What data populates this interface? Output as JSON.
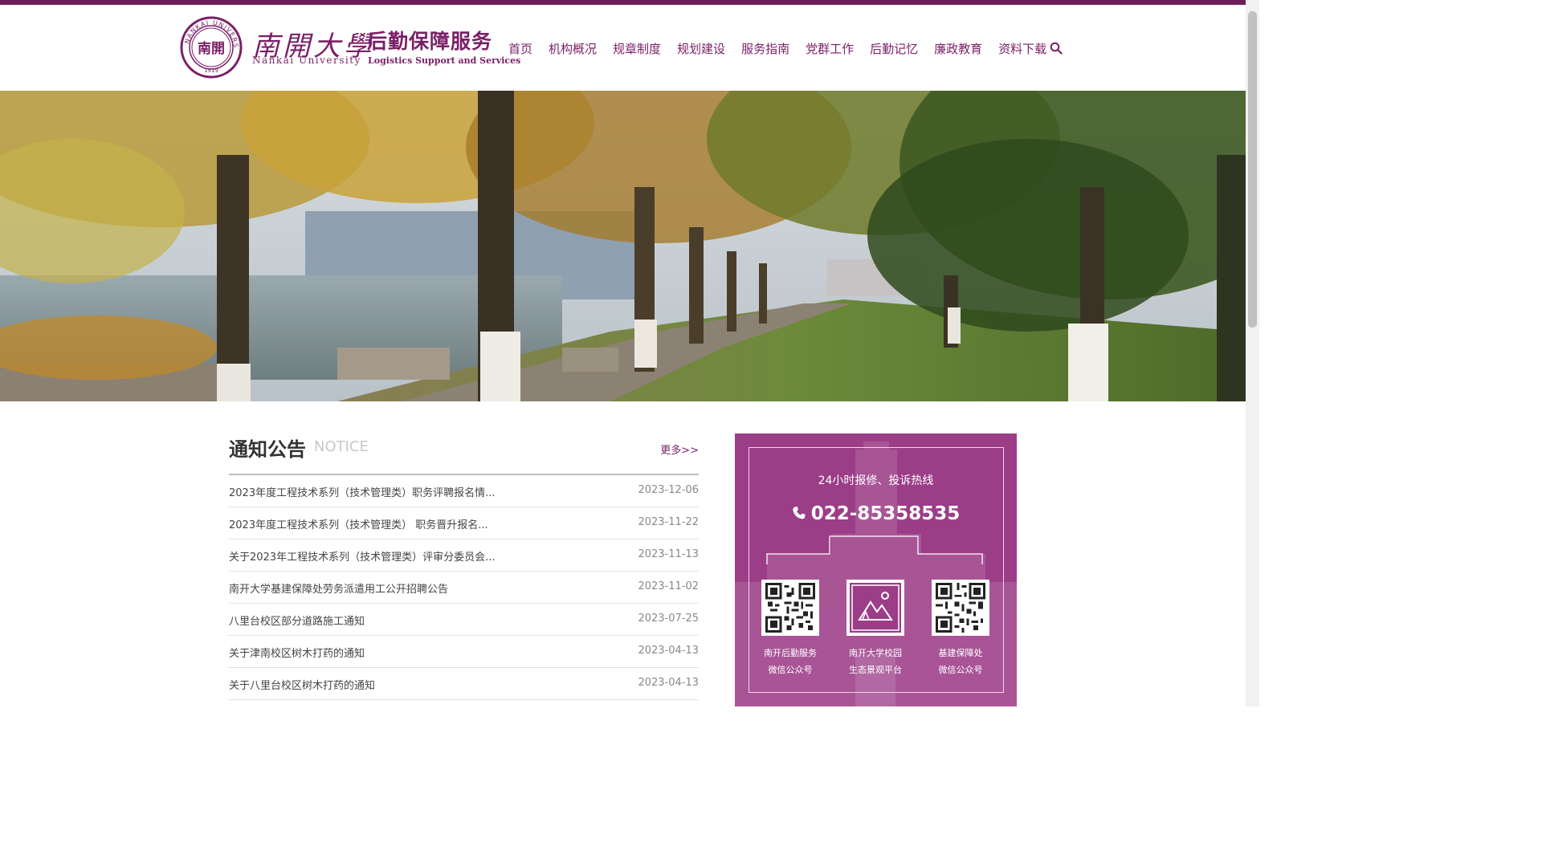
{
  "brand": {
    "seal_text": "NANKAI UNIVERSITY 1919",
    "seal_inner": "南開",
    "name_cn": "南開大學",
    "name_en": "Nankai University",
    "site_title": "后勤保障服务",
    "site_subtitle": "Logistics Support and Services",
    "color": "#7a1f66"
  },
  "nav": {
    "items": [
      "首页",
      "机构概况",
      "规章制度",
      "规划建设",
      "服务指南",
      "党群工作",
      "后勤记忆",
      "廉政教育",
      "资料下载"
    ],
    "search_icon": "search-icon"
  },
  "notice": {
    "title": "通知公告",
    "title_en": "NOTICE",
    "more": "更多>>",
    "items": [
      {
        "title": "2023年度工程技术系列（技术管理类）职务评聘报名情...",
        "date": "2023-12-06"
      },
      {
        "title": "2023年度工程技术系列（技术管理类） 职务晋升报名...",
        "date": "2023-11-22"
      },
      {
        "title": "关于2023年工程技术系列（技术管理类）评审分委员会...",
        "date": "2023-11-13"
      },
      {
        "title": "南开大学基建保障处劳务派遣用工公开招聘公告",
        "date": "2023-11-02"
      },
      {
        "title": "八里台校区部分道路施工通知",
        "date": "2023-07-25"
      },
      {
        "title": "关于津南校区树木打药的通知",
        "date": "2023-04-13"
      },
      {
        "title": "关于八里台校区树木打药的通知",
        "date": "2023-04-13"
      }
    ]
  },
  "hotline": {
    "label": "24小时报修、投诉热线",
    "phone": "022-85358535",
    "phone_icon": "phone-icon",
    "bg": "#9c3d88",
    "qrs": [
      {
        "line1": "南开后勤服务",
        "line2": "微信公众号"
      },
      {
        "line1": "南开大学校园",
        "line2": "生态景观平台"
      },
      {
        "line1": "基建保障处",
        "line2": "微信公众号"
      }
    ]
  }
}
